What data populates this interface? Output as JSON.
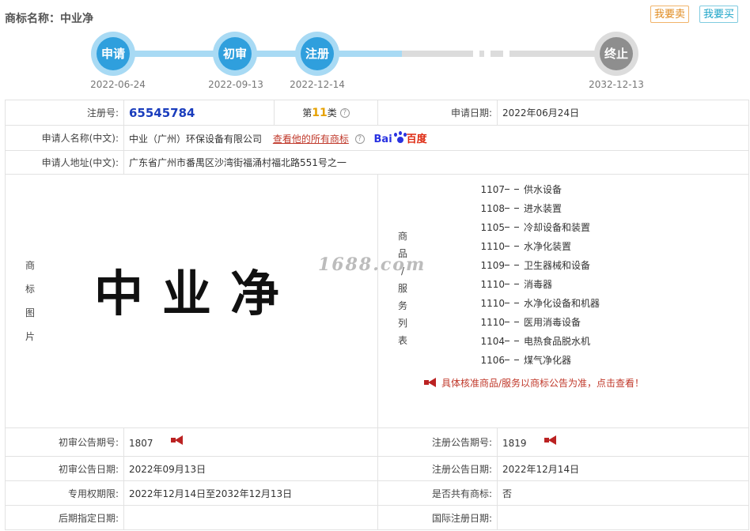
{
  "header": {
    "title": "商标名称：中业净",
    "sell_label": "我要卖",
    "buy_label": "我要买"
  },
  "timeline": [
    {
      "label": "申请",
      "date": "2022-06-24"
    },
    {
      "label": "初审",
      "date": "2022-09-13"
    },
    {
      "label": "注册",
      "date": "2022-12-14"
    },
    {
      "label": "终止",
      "date": "2032-12-13"
    }
  ],
  "info": {
    "reg_no_label": "注册号:",
    "reg_no": "65545784",
    "class_prefix": "第",
    "class_num": "11",
    "class_suffix": "类",
    "apply_date_label": "申请日期:",
    "apply_date": "2022年06月24日",
    "applicant_label": "申请人名称(中文):",
    "applicant": "中业（广州）环保设备有限公司",
    "view_all_link": "查看他的所有商标",
    "baidu_left": "Bai",
    "baidu_right": "百度",
    "address_label": "申请人地址(中文):",
    "address": "广东省广州市番禺区沙湾街福涌村福北路551号之一"
  },
  "mark": {
    "label_chars": [
      "商",
      "标",
      "图",
      "片"
    ],
    "text": "中业净",
    "watermark": "1688.com"
  },
  "goods": {
    "label_chars": [
      "商",
      "品",
      "/",
      "服",
      "务",
      "列",
      "表"
    ],
    "items": [
      {
        "code": "1107",
        "name": "供水设备"
      },
      {
        "code": "1108",
        "name": "进水装置"
      },
      {
        "code": "1105",
        "name": "冷却设备和装置"
      },
      {
        "code": "1110",
        "name": "水净化装置"
      },
      {
        "code": "1109",
        "name": "卫生器械和设备"
      },
      {
        "code": "1110",
        "name": "消毒器"
      },
      {
        "code": "1110",
        "name": "水净化设备和机器"
      },
      {
        "code": "1110",
        "name": "医用消毒设备"
      },
      {
        "code": "1104",
        "name": "电热食品脱水机"
      },
      {
        "code": "1106",
        "name": "煤气净化器"
      }
    ],
    "notice": "具体核准商品/服务以商标公告为准，点击查看！"
  },
  "announce": {
    "prelim_no_label": "初审公告期号:",
    "prelim_no": "1807",
    "reg_no_label": "注册公告期号:",
    "reg_no": "1819",
    "prelim_date_label": "初审公告日期:",
    "prelim_date": "2022年09月13日",
    "reg_date_label": "注册公告日期:",
    "reg_date": "2022年12月14日",
    "term_label": "专用权期限:",
    "term": "2022年12月14日至2032年12月13日",
    "shared_label": "是否共有商标:",
    "shared": "否",
    "later_label": "后期指定日期:",
    "later": "",
    "intl_label": "国际注册日期:",
    "intl": ""
  },
  "colors": {
    "accent_blue": "#2f9fdd",
    "stage_gray": "#8e8e8e",
    "link_red": "#c0392b",
    "reg_no_blue": "#1a3dbd"
  }
}
